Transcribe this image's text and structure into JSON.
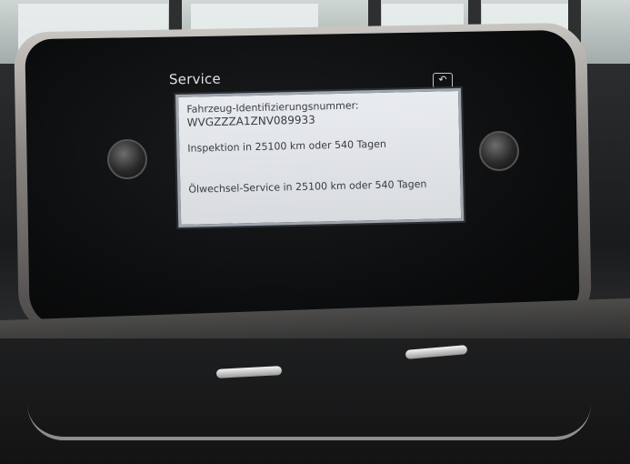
{
  "screen": {
    "title": "Service",
    "back_icon": "back-arrow-icon",
    "dialog": {
      "vin_label": "Fahrzeug-Identifizierungsnummer:",
      "vin_value": "WVGZZZA1ZNV089933",
      "inspection": "Inspektion in 25100 km oder 540 Tagen",
      "oil_service": "Ölwechsel-Service in 25100 km oder 540 Tagen"
    }
  },
  "colors": {
    "screen_bg": "#0b0c0d",
    "dialog_bg": "#e1e4e7",
    "dialog_border": "#9fa6ad",
    "title_text": "#dfe3e6"
  }
}
